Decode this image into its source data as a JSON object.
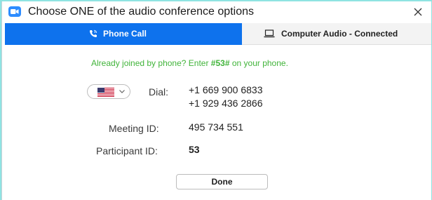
{
  "window": {
    "title": "Choose ONE of the audio conference options"
  },
  "tabs": [
    {
      "label": "Phone Call",
      "icon": "phone-icon",
      "selected": true
    },
    {
      "label": "Computer Audio - Connected",
      "icon": "laptop-icon",
      "selected": false
    }
  ],
  "phone_call": {
    "info_prefix": "Already joined by phone? Enter ",
    "info_code": "#53#",
    "info_suffix": " on your phone.",
    "country_select": {
      "flag": "us-flag-icon"
    },
    "dial_label": "Dial:",
    "dial_numbers": [
      "+1 669 900 6833",
      "+1 929 436 2866"
    ],
    "meeting_id_label": "Meeting ID:",
    "meeting_id": "495 734 551",
    "participant_id_label": "Participant ID:",
    "participant_id": "53"
  },
  "buttons": {
    "done_label": "Done"
  },
  "colors": {
    "tab_active": "#0e72ed",
    "info_text": "#41b43a",
    "frame": "#8fe3e2"
  }
}
